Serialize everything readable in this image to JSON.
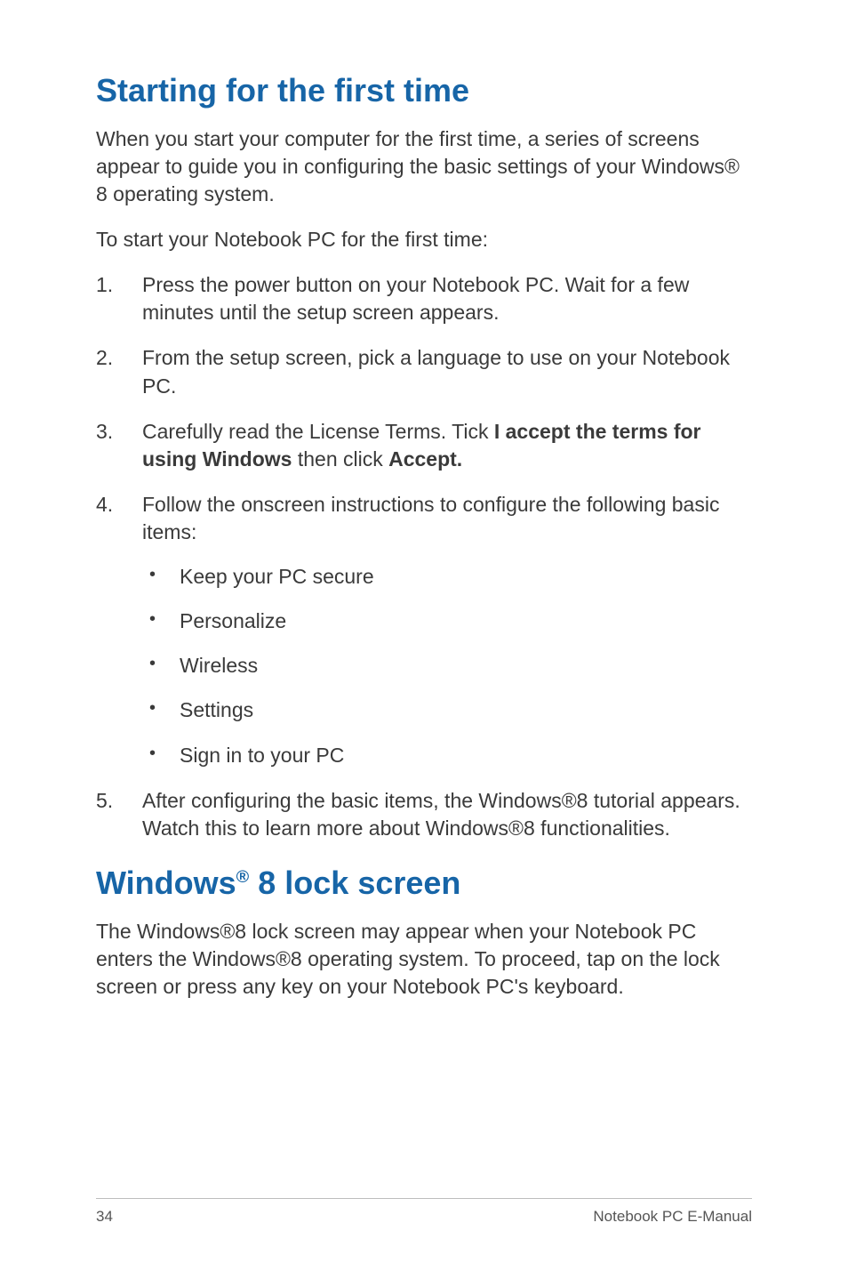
{
  "heading1": "Starting for the first time",
  "intro1": "When you start your computer for the first time, a series of screens appear to guide you in configuring the basic settings of your Windows® 8 operating system.",
  "intro2": "To start your Notebook PC for the first time:",
  "steps": {
    "s1": "Press the power button on your Notebook PC. Wait for a few minutes until the setup screen appears.",
    "s2": "From the setup screen, pick a language to use on your Notebook PC.",
    "s3_prefix": "Carefully read the License Terms. Tick ",
    "s3_bold1": "I accept the terms for using Windows",
    "s3_mid": " then click ",
    "s3_bold2": "Accept.",
    "s4": "Follow the onscreen instructions to configure the following basic items:",
    "s4_bullets": {
      "b1": "Keep your PC secure",
      "b2": "Personalize",
      "b3": "Wireless",
      "b4": "Settings",
      "b5": "Sign in to your PC"
    },
    "s5": "After configuring the basic items, the Windows®8 tutorial appears. Watch this to learn more about Windows®8 functionalities."
  },
  "heading2_pre": "Windows",
  "heading2_sup": "®",
  "heading2_post": " 8 lock screen",
  "lock_body": "The Windows®8 lock screen may appear when your Notebook PC enters the Windows®8 operating system. To proceed,  tap on the lock screen or press any key on your Notebook PC's keyboard.",
  "footer": {
    "page": "34",
    "title": "Notebook PC E-Manual"
  }
}
